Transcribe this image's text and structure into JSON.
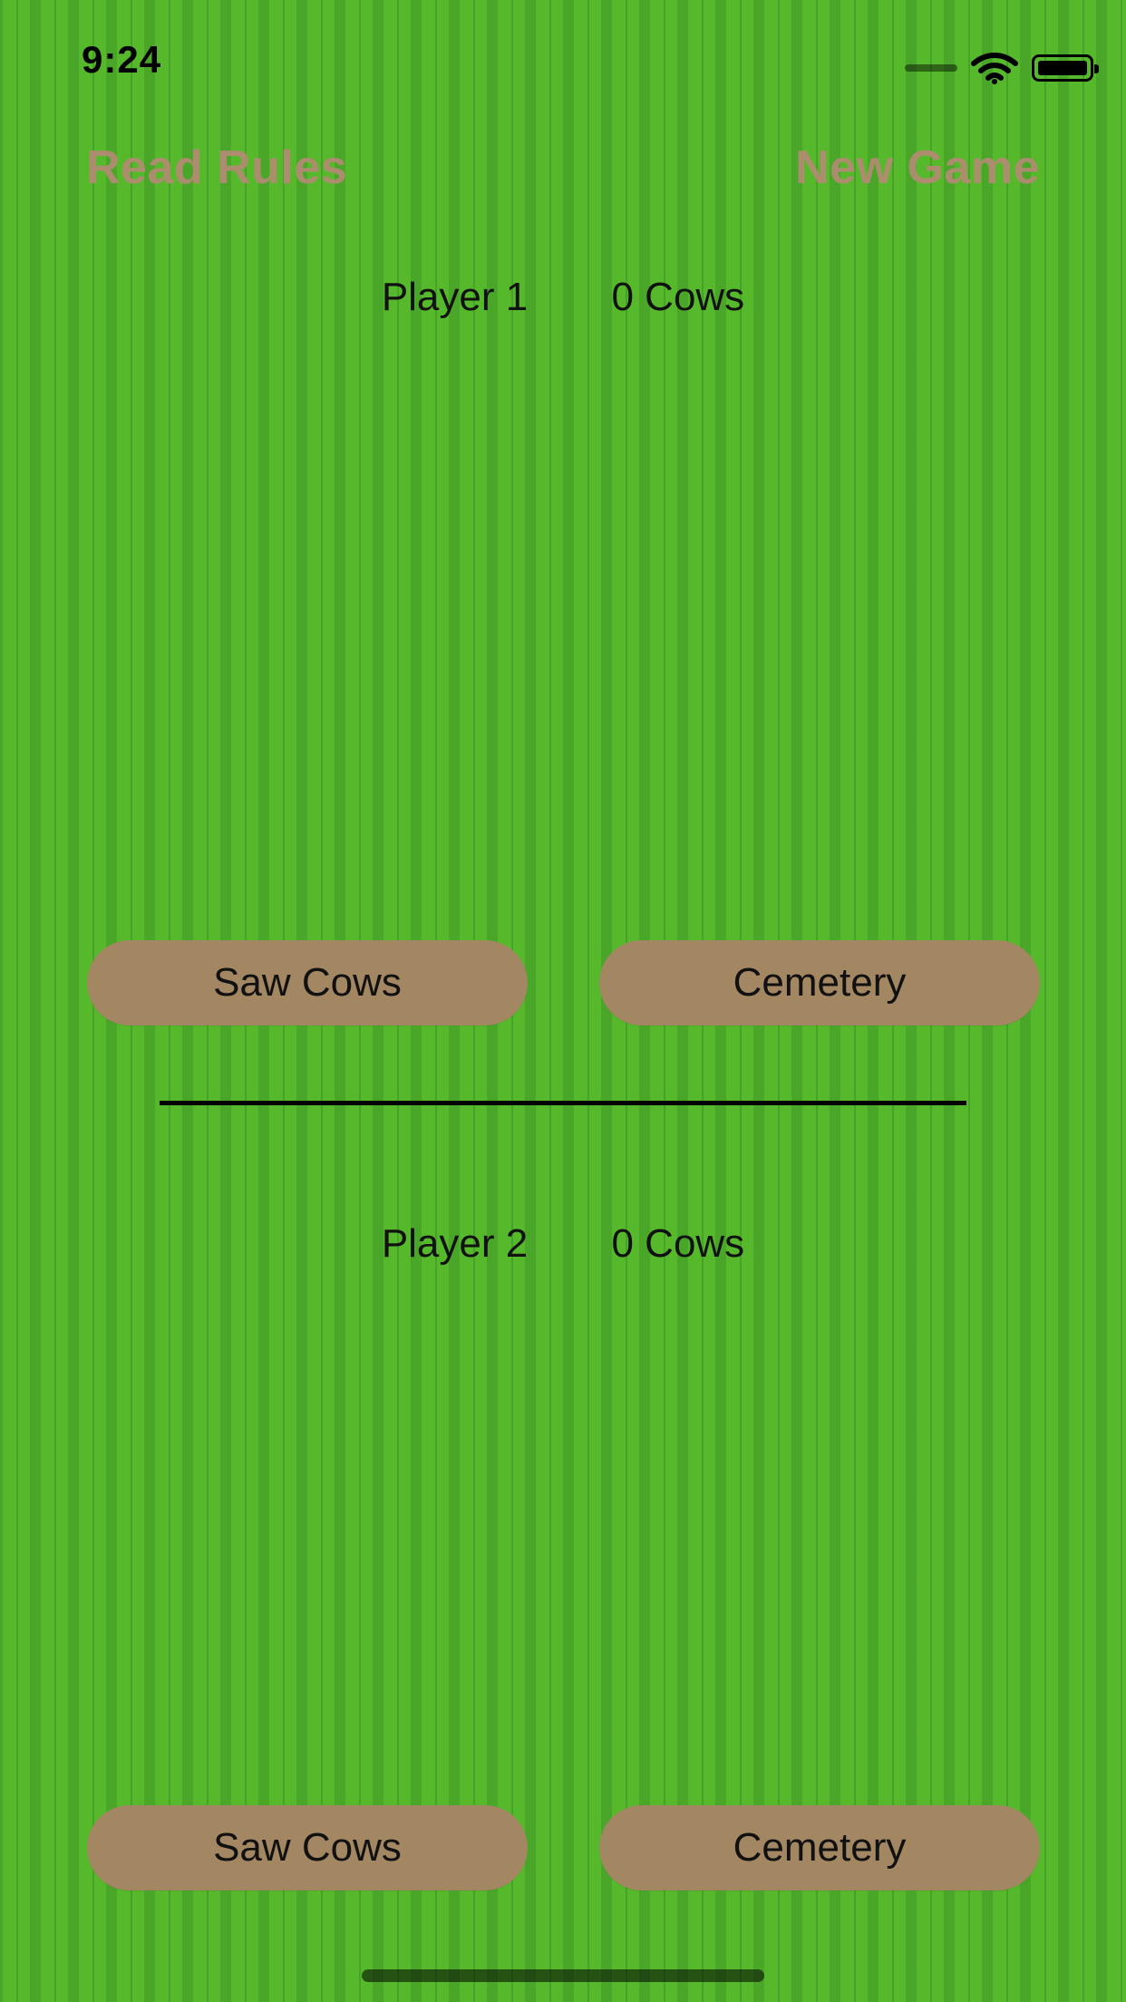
{
  "status_bar": {
    "time": "9:24",
    "icons": [
      "signal-dots-icon",
      "wifi-icon",
      "battery-icon"
    ]
  },
  "top_actions": {
    "read_rules": "Read Rules",
    "new_game": "New Game"
  },
  "players": [
    {
      "name": "Player 1",
      "cows": "0 Cows",
      "saw_cows": "Saw Cows",
      "cemetery": "Cemetery"
    },
    {
      "name": "Player 2",
      "cows": "0 Cows",
      "saw_cows": "Saw Cows",
      "cemetery": "Cemetery"
    }
  ],
  "colors": {
    "background": "#55b92b",
    "button_fill": "#a38662",
    "top_link_text": "#b68a76",
    "divider": "#000000"
  }
}
